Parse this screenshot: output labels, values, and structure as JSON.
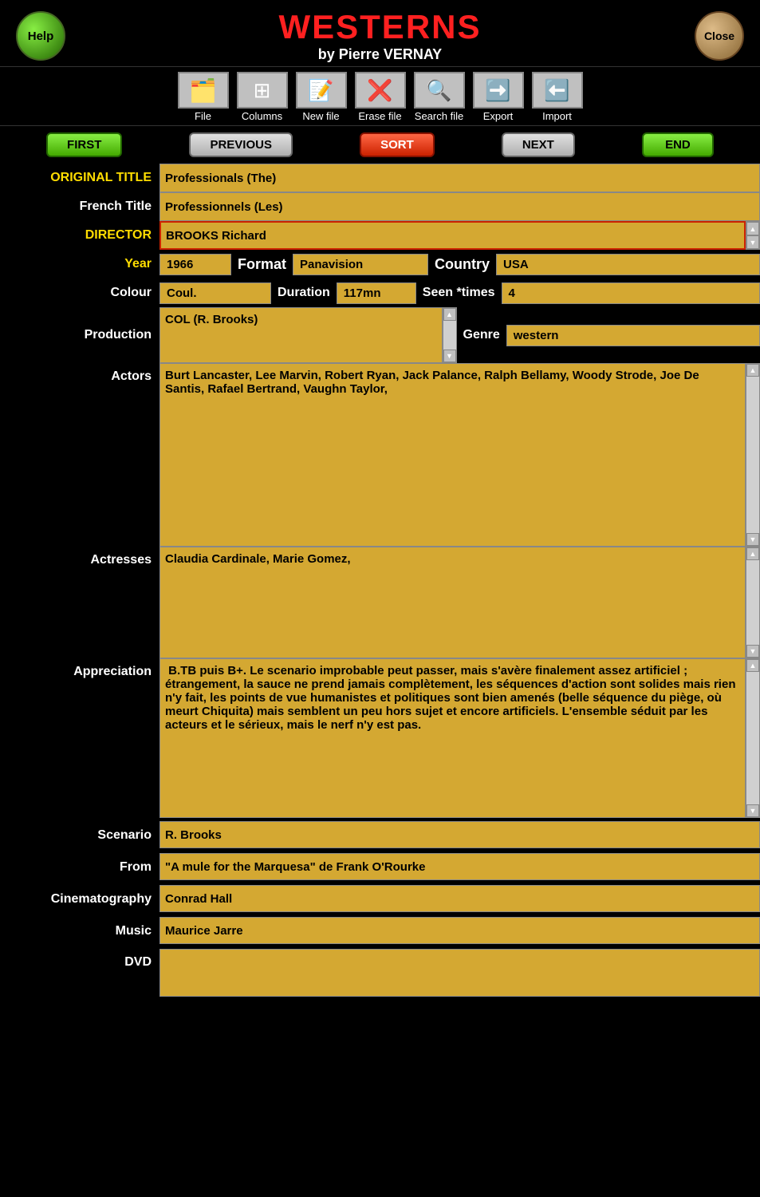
{
  "app": {
    "title": "WESTERNS",
    "subtitle": "by Pierre VERNAY",
    "help_label": "Help",
    "close_label": "Close"
  },
  "toolbar": {
    "items": [
      {
        "label": "File",
        "icon": "📋"
      },
      {
        "label": "Columns",
        "icon": "📊"
      },
      {
        "label": "New file",
        "icon": "📄"
      },
      {
        "label": "Erase file",
        "icon": "❌"
      },
      {
        "label": "Search file",
        "icon": "🔍"
      },
      {
        "label": "Export",
        "icon": "➡"
      },
      {
        "label": "Import",
        "icon": "⬅"
      }
    ]
  },
  "nav": {
    "first": "FIRST",
    "previous": "PREVIOUS",
    "sort": "SORT",
    "next": "NEXT",
    "end": "END"
  },
  "fields": {
    "original_title_label": "ORIGINAL  TITLE",
    "original_title_value": "Professionals (The)",
    "french_title_label": "French Title",
    "french_title_value": "Professionnels (Les)",
    "director_label": "DIRECTOR",
    "director_value": "BROOKS Richard",
    "year_label": "Year",
    "year_value": "1966",
    "format_label": "Format",
    "format_value": "Panavision",
    "country_label": "Country",
    "country_value": "USA",
    "colour_label": "Colour",
    "colour_value": "Coul.",
    "duration_label": "Duration",
    "duration_value": "117mn",
    "seen_label": "Seen *times",
    "seen_value": "4",
    "production_label": "Production",
    "production_value": "COL (R. Brooks)",
    "genre_label": "Genre",
    "genre_value": "western",
    "actors_label": "Actors",
    "actors_value": "Burt Lancaster, Lee Marvin, Robert Ryan, Jack Palance, Ralph Bellamy, Woody Strode, Joe De Santis, Rafael Bertrand, Vaughn Taylor,",
    "actresses_label": "Actresses",
    "actresses_value": "Claudia Cardinale, Marie Gomez,",
    "appreciation_label": "Appreciation",
    "appreciation_value": " B.TB puis B+. Le scenario improbable peut passer, mais s'avère finalement assez artificiel ; étrangement, la sauce ne prend jamais complètement, les séquences d'action sont solides mais rien n'y fait, les points de vue humanistes et politiques sont bien amenés (belle séquence du piège, où meurt Chiquita) mais semblent un peu hors sujet et encore artificiels. L'ensemble séduit par les acteurs et le sérieux, mais le nerf n'y est pas.",
    "scenario_label": "Scenario",
    "scenario_value": "R. Brooks",
    "from_label": "From",
    "from_value": "\"A mule for the Marquesa\" de Frank O'Rourke",
    "cinematography_label": "Cinematography",
    "cinematography_value": "Conrad Hall",
    "music_label": "Music",
    "music_value": "Maurice Jarre",
    "dvd_label": "DVD",
    "dvd_value": ""
  }
}
